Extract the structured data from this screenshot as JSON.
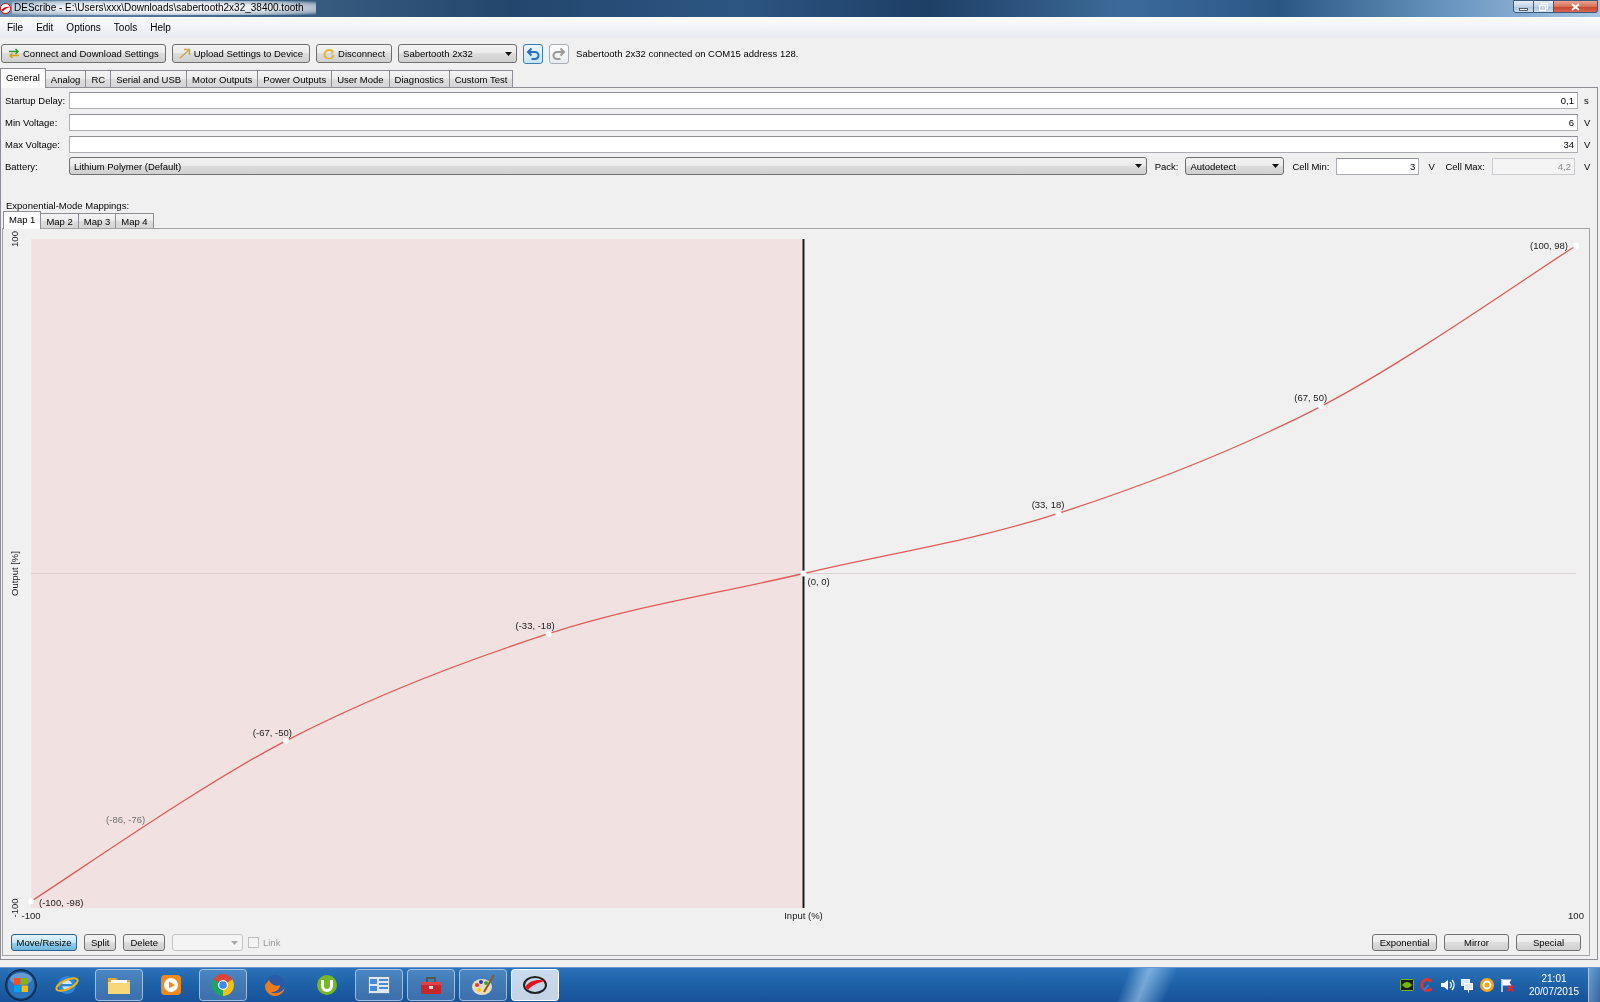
{
  "window": {
    "title": "DEScribe - E:\\Users\\xxx\\Downloads\\sabertooth2x32_38400.tooth"
  },
  "menu": [
    "File",
    "Edit",
    "Options",
    "Tools",
    "Help"
  ],
  "toolbar": {
    "buttons": [
      {
        "kind": "connect",
        "label": "Connect and Download Settings"
      },
      {
        "kind": "upload",
        "label": "Upload Settings to Device"
      },
      {
        "kind": "disconnect",
        "label": "Disconnect"
      }
    ],
    "device": "Sabertooth 2x32",
    "history": [
      {
        "kind": "undo",
        "disabled": false
      },
      {
        "kind": "redo",
        "disabled": true
      }
    ],
    "status": "Sabertooth 2x32 connected on COM15 address 128."
  },
  "tabs": [
    {
      "label": "General",
      "selected": true
    },
    {
      "label": "Analog",
      "selected": false
    },
    {
      "label": "RC",
      "selected": false
    },
    {
      "label": "Serial and USB",
      "selected": false
    },
    {
      "label": "Motor Outputs",
      "selected": false
    },
    {
      "label": "Power Outputs",
      "selected": false
    },
    {
      "label": "User Mode",
      "selected": false
    },
    {
      "label": "Diagnostics",
      "selected": false
    },
    {
      "label": "Custom Test",
      "selected": false
    }
  ],
  "settings": [
    {
      "label": "Startup Delay:",
      "value": "0,1",
      "unit": "s"
    },
    {
      "label": "Min Voltage:",
      "value": "6",
      "unit": "V"
    },
    {
      "label": "Max Voltage:",
      "value": "34",
      "unit": "V"
    }
  ],
  "battery": [
    {
      "kind": "dropdown",
      "label": "Battery:",
      "value": "Lithium Polymer (Default)"
    },
    {
      "kind": "dropdown",
      "label": "Pack:",
      "value": "Autodetect"
    },
    {
      "kind": "field",
      "label": "Cell Min:",
      "value": "3",
      "unit": "V",
      "disabled": false
    },
    {
      "kind": "field",
      "label": "Cell Max:",
      "value": "4,2",
      "unit": "V",
      "disabled": true
    }
  ],
  "mapping": {
    "label": "Exponential-Mode Mappings:",
    "tabs": [
      {
        "label": "Map 1",
        "selected": true
      },
      {
        "label": "Map 2",
        "selected": false
      },
      {
        "label": "Map 3",
        "selected": false
      },
      {
        "label": "Map 4",
        "selected": false
      }
    ],
    "chart_data": {
      "type": "line",
      "xlabel": "Input (%)",
      "ylabel": "Output [%]",
      "x": [
        -100,
        -67,
        -33,
        0,
        33,
        67,
        100
      ],
      "series": [
        {
          "color": "#e05a5a",
          "marker": "circle",
          "values": [
            -98,
            -50,
            -18,
            0,
            18,
            50,
            98
          ]
        }
      ],
      "xlim": [
        -100,
        100
      ],
      "ylim": [
        -100,
        100
      ],
      "xticks": [
        -100,
        100
      ],
      "yticks": [
        -100,
        100
      ],
      "value_labels": [
        "(-100, -98)",
        "(-67, -50)",
        "(-33, -18)",
        "(0, 0)",
        "(33, 18)",
        "(67, 50)",
        "(100, 98)"
      ],
      "bands": [
        {
          "axis": "x",
          "from": -100,
          "to": 0
        }
      ],
      "ref_lines": [
        {
          "axis": "x",
          "value": 0
        }
      ],
      "annotations": [
        {
          "text": "(-86, -76)",
          "x": -86,
          "y": -76
        }
      ]
    },
    "tools": [
      {
        "kind": "move",
        "label": "Move/Resize",
        "selected": true
      },
      {
        "kind": "split",
        "label": "Split",
        "selected": false
      },
      {
        "kind": "delete",
        "label": "Delete",
        "selected": false
      }
    ],
    "dropdown": {
      "disabled": true
    },
    "link": {
      "label": "Link",
      "checked": false,
      "disabled": true
    },
    "actions": [
      "Exponential",
      "Mirror",
      "Special"
    ]
  },
  "taskbar": {
    "items": [
      {
        "kind": "browser_e",
        "running": false,
        "active": false
      },
      {
        "kind": "folder",
        "running": true,
        "active": false
      },
      {
        "kind": "media",
        "running": false,
        "active": false
      },
      {
        "kind": "browser_round",
        "running": true,
        "active": false
      },
      {
        "kind": "browser_fox",
        "running": false,
        "active": false
      },
      {
        "kind": "torrent",
        "running": false,
        "active": false
      },
      {
        "kind": "control_panel",
        "running": true,
        "active": false
      },
      {
        "kind": "toolbox",
        "running": true,
        "active": false
      },
      {
        "kind": "paint",
        "running": true,
        "active": false
      },
      {
        "kind": "app",
        "running": true,
        "active": true
      }
    ],
    "tray": [
      {
        "kind": "chip"
      },
      {
        "kind": "cleaner"
      },
      {
        "kind": "speaker"
      },
      {
        "kind": "network"
      },
      {
        "kind": "ring"
      },
      {
        "kind": "flag"
      }
    ],
    "time": "21:01",
    "date": "20/07/2015"
  }
}
